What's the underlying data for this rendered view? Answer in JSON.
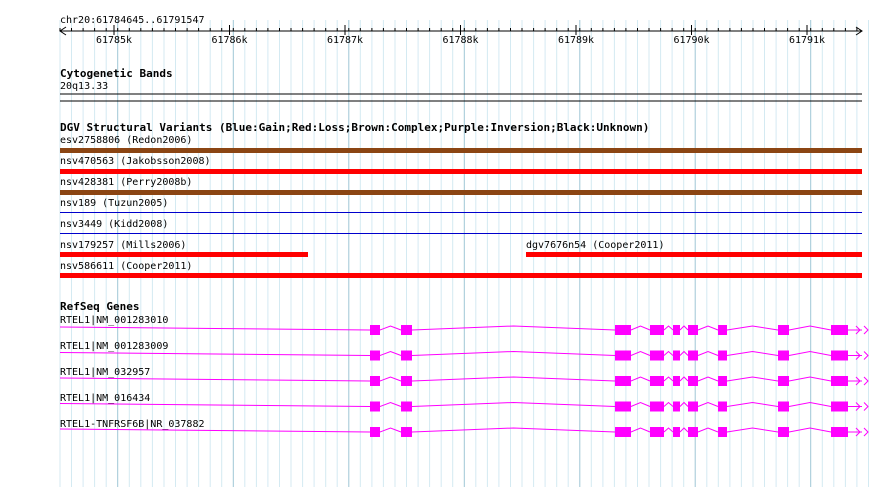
{
  "ruler": {
    "region": "chr20:61784645..61791547",
    "ticks": [
      "61785k",
      "61786k",
      "61787k",
      "61788k",
      "61789k",
      "61790k",
      "61791k"
    ]
  },
  "cytobands": {
    "title": "Cytogenetic Bands",
    "band": "20q13.33"
  },
  "dgv": {
    "title": "DGV Structural Variants (Blue:Gain;Red:Loss;Brown:Complex;Purple:Inversion;Black:Unknown)",
    "colors": {
      "gain": "#0000cc",
      "loss": "#ff0000",
      "complex": "#8b4513",
      "inversion": "#800080",
      "unknown": "#000000"
    },
    "variants": [
      {
        "label": "esv2758806 (Redon2006)",
        "type": "complex"
      },
      {
        "label": "nsv470563 (Jakobsson2008)",
        "type": "loss"
      },
      {
        "label": "nsv428381 (Perry2008b)",
        "type": "complex"
      },
      {
        "label": "nsv189 (Tuzun2005)",
        "type": "gain"
      },
      {
        "label": "nsv3449 (Kidd2008)",
        "type": "gain"
      },
      {
        "label": "nsv179257 (Mills2006)",
        "type": "loss"
      },
      {
        "label": "dgv7676n54 (Cooper2011)",
        "type": "loss"
      },
      {
        "label": "nsv586611 (Cooper2011)",
        "type": "loss"
      }
    ]
  },
  "refseq": {
    "title": "RefSeq Genes",
    "color": "#ff00ff",
    "genes": [
      {
        "label": "RTEL1|NM_001283010"
      },
      {
        "label": "RTEL1|NM_001283009"
      },
      {
        "label": "RTEL1|NM_032957"
      },
      {
        "label": "RTEL1|NM_016434"
      },
      {
        "label": "RTEL1-TNFRSF6B|NR_037882"
      }
    ]
  }
}
